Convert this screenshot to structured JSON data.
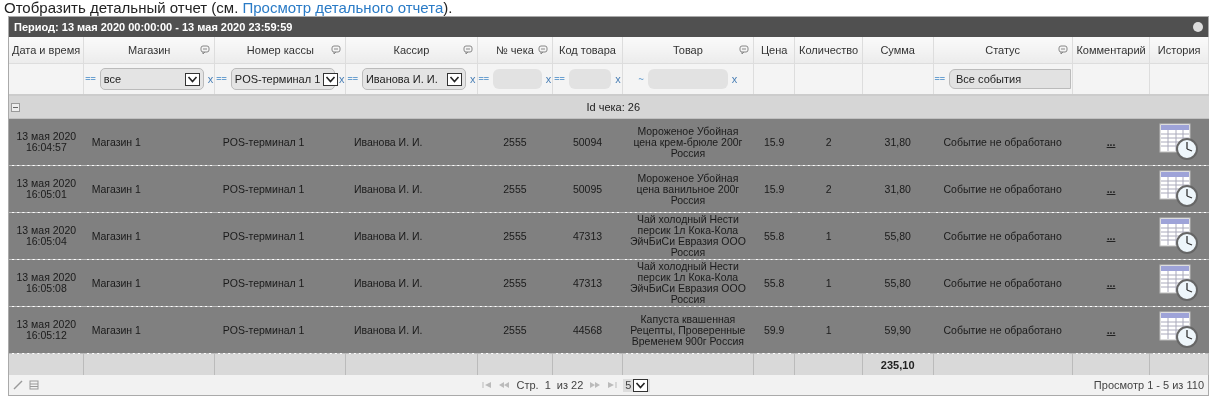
{
  "intro": {
    "text": "Отобразить детальный отчет (см. ",
    "link": "Просмотр детального отчета",
    "suffix": ")."
  },
  "panel": {
    "title": "Период: 13 мая 2020 00:00:00 - 13 мая 2020 23:59:59"
  },
  "columns": [
    {
      "label": "Дата и время",
      "has_menu": false
    },
    {
      "label": "Магазин",
      "has_menu": true,
      "filter": {
        "op": "==",
        "kind": "select",
        "value": "все",
        "clear": "x"
      }
    },
    {
      "label": "Номер кассы",
      "has_menu": true,
      "filter": {
        "op": "==",
        "kind": "select",
        "value": "POS-терминал 1",
        "clear": "x"
      }
    },
    {
      "label": "Кассир",
      "has_menu": true,
      "filter": {
        "op": "==",
        "kind": "select",
        "value": "Иванова И. И.",
        "clear": "x"
      }
    },
    {
      "label": "№ чека",
      "has_menu": true,
      "filter": {
        "op": "==",
        "kind": "input",
        "clear": "x"
      }
    },
    {
      "label": "Код товара",
      "has_menu": false,
      "filter": {
        "op": "==",
        "kind": "input",
        "clear": "x"
      }
    },
    {
      "label": "Товар",
      "has_menu": true,
      "filter": {
        "op": "~",
        "kind": "input",
        "clear": "x"
      }
    },
    {
      "label": "Цена",
      "has_menu": false
    },
    {
      "label": "Количество",
      "has_menu": false
    },
    {
      "label": "Сумма",
      "has_menu": false,
      "total": "235,10"
    },
    {
      "label": "Статус",
      "has_menu": true,
      "filter": {
        "op": "==",
        "kind": "input",
        "value": "Все события"
      }
    },
    {
      "label": "Комментарий",
      "has_menu": false
    },
    {
      "label": "История",
      "has_menu": false
    }
  ],
  "group": {
    "label": "Id чека: 26"
  },
  "rows": [
    {
      "cells": [
        "13 мая 2020\n16:04:57",
        "Магазин 1",
        "POS-терминал 1",
        "Иванова И. И.",
        "2555",
        "50094",
        "Мороженое Убойная цена крем-брюле 200г Россия",
        "15.9",
        "2",
        "31,80",
        "Событие не обработано",
        "..."
      ]
    },
    {
      "cells": [
        "13 мая 2020\n16:05:01",
        "Магазин 1",
        "POS-терминал 1",
        "Иванова И. И.",
        "2555",
        "50095",
        "Мороженое Убойная цена ванильное 200г Россия",
        "15.9",
        "2",
        "31,80",
        "Событие не обработано",
        "..."
      ]
    },
    {
      "cells": [
        "13 мая 2020\n16:05:04",
        "Магазин 1",
        "POS-терминал 1",
        "Иванова И. И.",
        "2555",
        "47313",
        "Чай холодный Нести персик 1л Кока-Кола ЭйчБиСи Евразия ООО Россия",
        "55.8",
        "1",
        "55,80",
        "Событие не обработано",
        "..."
      ]
    },
    {
      "cells": [
        "13 мая 2020\n16:05:08",
        "Магазин 1",
        "POS-терминал 1",
        "Иванова И. И.",
        "2555",
        "47313",
        "Чай холодный Нести персик 1л Кока-Кола ЭйчБиСи Евразия ООО Россия",
        "55.8",
        "1",
        "55,80",
        "Событие не обработано",
        "..."
      ]
    },
    {
      "cells": [
        "13 мая 2020\n16:05:12",
        "Магазин 1",
        "POS-терминал 1",
        "Иванова И. И.",
        "2555",
        "44568",
        "Капуста квашенная Рецепты, Проверенные Временем 900г Россия",
        "59.9",
        "1",
        "59,90",
        "Событие не обработано",
        "..."
      ]
    }
  ],
  "pager": {
    "page_label": "Стр.",
    "page": "1",
    "of": "из 22",
    "page_size": "5",
    "summary": "Просмотр 1 - 5 из 110"
  }
}
